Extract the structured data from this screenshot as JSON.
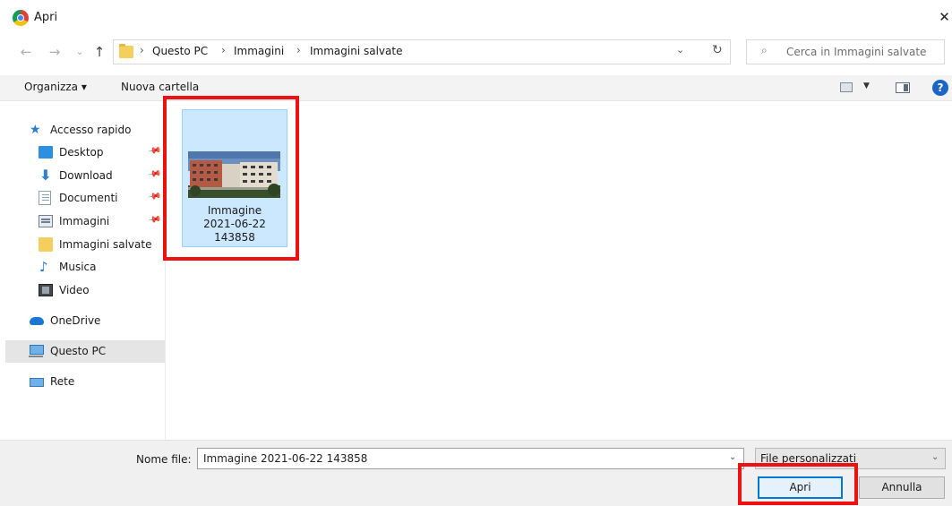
{
  "window": {
    "title": "Apri",
    "close_glyph": "✕"
  },
  "nav": {
    "back_glyph": "←",
    "forward_glyph": "→",
    "recent_glyph": "⌄",
    "up_glyph": "↑",
    "breadcrumbs": [
      "Questo PC",
      "Immagini",
      "Immagini salvate"
    ],
    "separator": "›",
    "dropdown_glyph": "⌄",
    "refresh_glyph": "↻",
    "search_placeholder": "Cerca in Immagini salvate",
    "search_glyph": "⌕"
  },
  "toolbar": {
    "organize_label": "Organizza ▾",
    "new_folder_label": "Nuova cartella",
    "view_dropdown_glyph": "▼",
    "help_glyph": "?"
  },
  "sidebar": {
    "pin_glyph": "📌",
    "items": [
      {
        "label": "Accesso rapido",
        "icon": "star-icon"
      },
      {
        "label": "Desktop",
        "icon": "desktop-icon",
        "pinned": true
      },
      {
        "label": "Download",
        "icon": "download-icon",
        "pinned": true
      },
      {
        "label": "Documenti",
        "icon": "documents-icon",
        "pinned": true
      },
      {
        "label": "Immagini",
        "icon": "images-icon",
        "pinned": true
      },
      {
        "label": "Immagini salvate",
        "icon": "folder-icon"
      },
      {
        "label": "Musica",
        "icon": "music-icon"
      },
      {
        "label": "Video",
        "icon": "video-icon"
      },
      {
        "label": "OneDrive",
        "icon": "onedrive-icon"
      },
      {
        "label": "Questo PC",
        "icon": "computer-icon",
        "selected": true
      },
      {
        "label": "Rete",
        "icon": "network-icon"
      }
    ]
  },
  "files": [
    {
      "name_lines": [
        "Immagine",
        "2021-06-22",
        "143858"
      ],
      "selected": true
    }
  ],
  "bottom": {
    "filename_label": "Nome file:",
    "filename_value": "Immagine 2021-06-22 143858",
    "filetype_value": "File personalizzati",
    "dropdown_glyph": "⌄",
    "open_label": "Apri",
    "cancel_label": "Annulla"
  },
  "colors": {
    "highlight_red": "#ee1111",
    "selection_blue": "#cce8ff",
    "primary_button_border": "#0078d7"
  }
}
